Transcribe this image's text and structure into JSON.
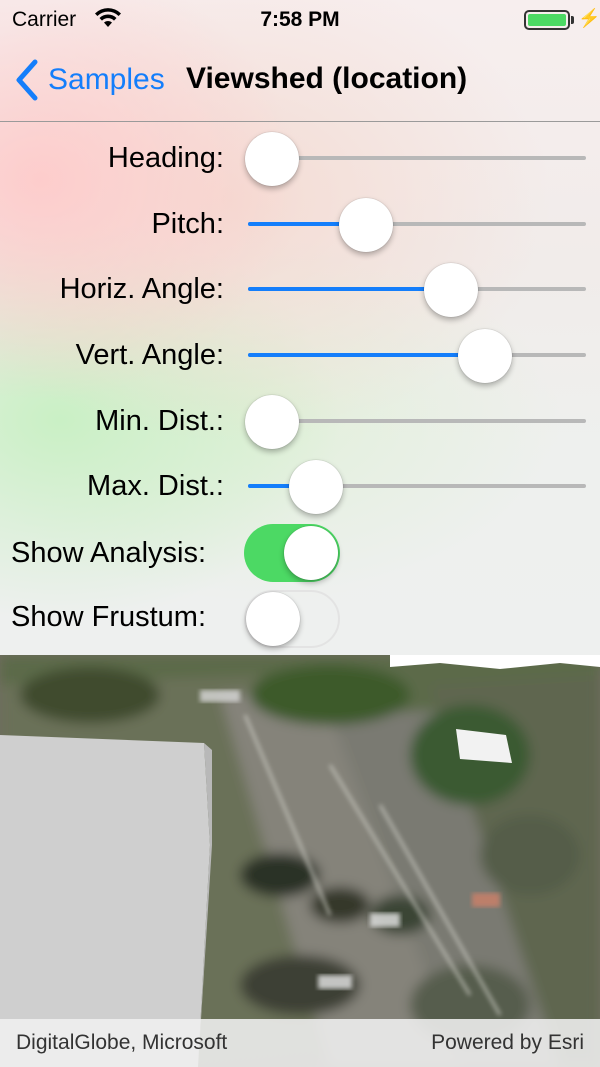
{
  "status_bar": {
    "carrier": "Carrier",
    "time": "7:58 PM",
    "battery_color": "#4cd964"
  },
  "nav": {
    "back_label": "Samples",
    "title": "Viewshed (location)"
  },
  "controls": {
    "heading": {
      "label": "Heading:",
      "value": 0.07
    },
    "pitch": {
      "label": "Pitch:",
      "value": 0.35
    },
    "horiz_angle": {
      "label": "Horiz. Angle:",
      "value": 0.6
    },
    "vert_angle": {
      "label": "Vert. Angle:",
      "value": 0.7
    },
    "min_dist": {
      "label": "Min. Dist.:",
      "value": 0.07
    },
    "max_dist": {
      "label": "Max. Dist.:",
      "value": 0.2
    },
    "show_analysis": {
      "label": "Show Analysis:",
      "on": true
    },
    "show_frustum": {
      "label": "Show Frustum:",
      "on": false
    }
  },
  "map": {
    "attribution_left": "DigitalGlobe, Microsoft",
    "attribution_right": "Powered by Esri"
  },
  "colors": {
    "accent": "#147efb",
    "switch_on": "#4cd964"
  }
}
